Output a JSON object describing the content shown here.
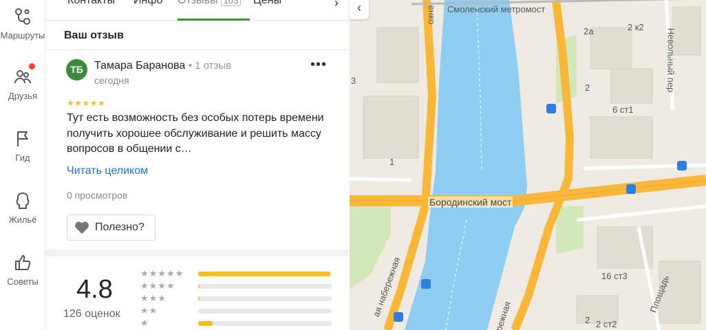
{
  "rail": {
    "items": [
      {
        "label": "Маршруты",
        "icon": "routes-icon"
      },
      {
        "label": "Друзья",
        "icon": "friends-icon",
        "badge": true
      },
      {
        "label": "Гид",
        "icon": "flag-icon"
      },
      {
        "label": "Жильё",
        "icon": "housing-icon"
      },
      {
        "label": "Советы",
        "icon": "thumbs-up-icon"
      }
    ]
  },
  "tabs": {
    "items": [
      "Контакты",
      "Инфо",
      "Отзывы",
      "Цены"
    ],
    "reviews_count": "103",
    "active": "Отзывы"
  },
  "your_review": {
    "title": "Ваш отзыв",
    "avatar_initials": "ТБ",
    "author": "Тамара Баранова",
    "author_meta": "1 отзыв",
    "date": "сегодня",
    "stars": "★★★★★",
    "text": "Тут есть возможность без особых потерь времени получить хорошее обслуживание и решить массу вопросов в общении с…",
    "read_more": "Читать целиком",
    "views": "0 просмотров",
    "useful_label": "Полезно?",
    "rating": 5
  },
  "summary": {
    "rating": "4.8",
    "count_label": "126 оценок",
    "distribution": [
      {
        "stars": "★★★★★",
        "fraction": 0.99
      },
      {
        "stars": "★★★★",
        "fraction": 0.01
      },
      {
        "stars": "★★★",
        "fraction": 0.01
      },
      {
        "stars": "★★",
        "fraction": 0.0
      },
      {
        "stars": "★",
        "fraction": 0.11
      }
    ]
  },
  "map": {
    "labels": {
      "metromost": "Смоленский метромост",
      "bridge": "Бородинский мост",
      "nevolny": "Невольный пер",
      "embankment1": "ая набережная",
      "embankment2": "ережная",
      "ploschad": "Площадь",
      "b2k2": "2 к2",
      "b2a": "2а",
      "b2": "2",
      "b6st1": "6 ст1",
      "b16st3": "16 ст3",
      "b2st2": "2 ст2",
      "b1": "1",
      "b3": "3",
      "b2b": "2",
      "bnko": "енко"
    },
    "colors": {
      "water": "#8fcdf3",
      "road": "#f9b73a",
      "land": "#efebe2",
      "park": "#d3e8b8"
    }
  },
  "colors": {
    "accent_green": "#3a9b2a",
    "link_blue": "#1a73c8",
    "star_yellow": "#fbbd1e",
    "badge_red": "#ff3b30"
  }
}
